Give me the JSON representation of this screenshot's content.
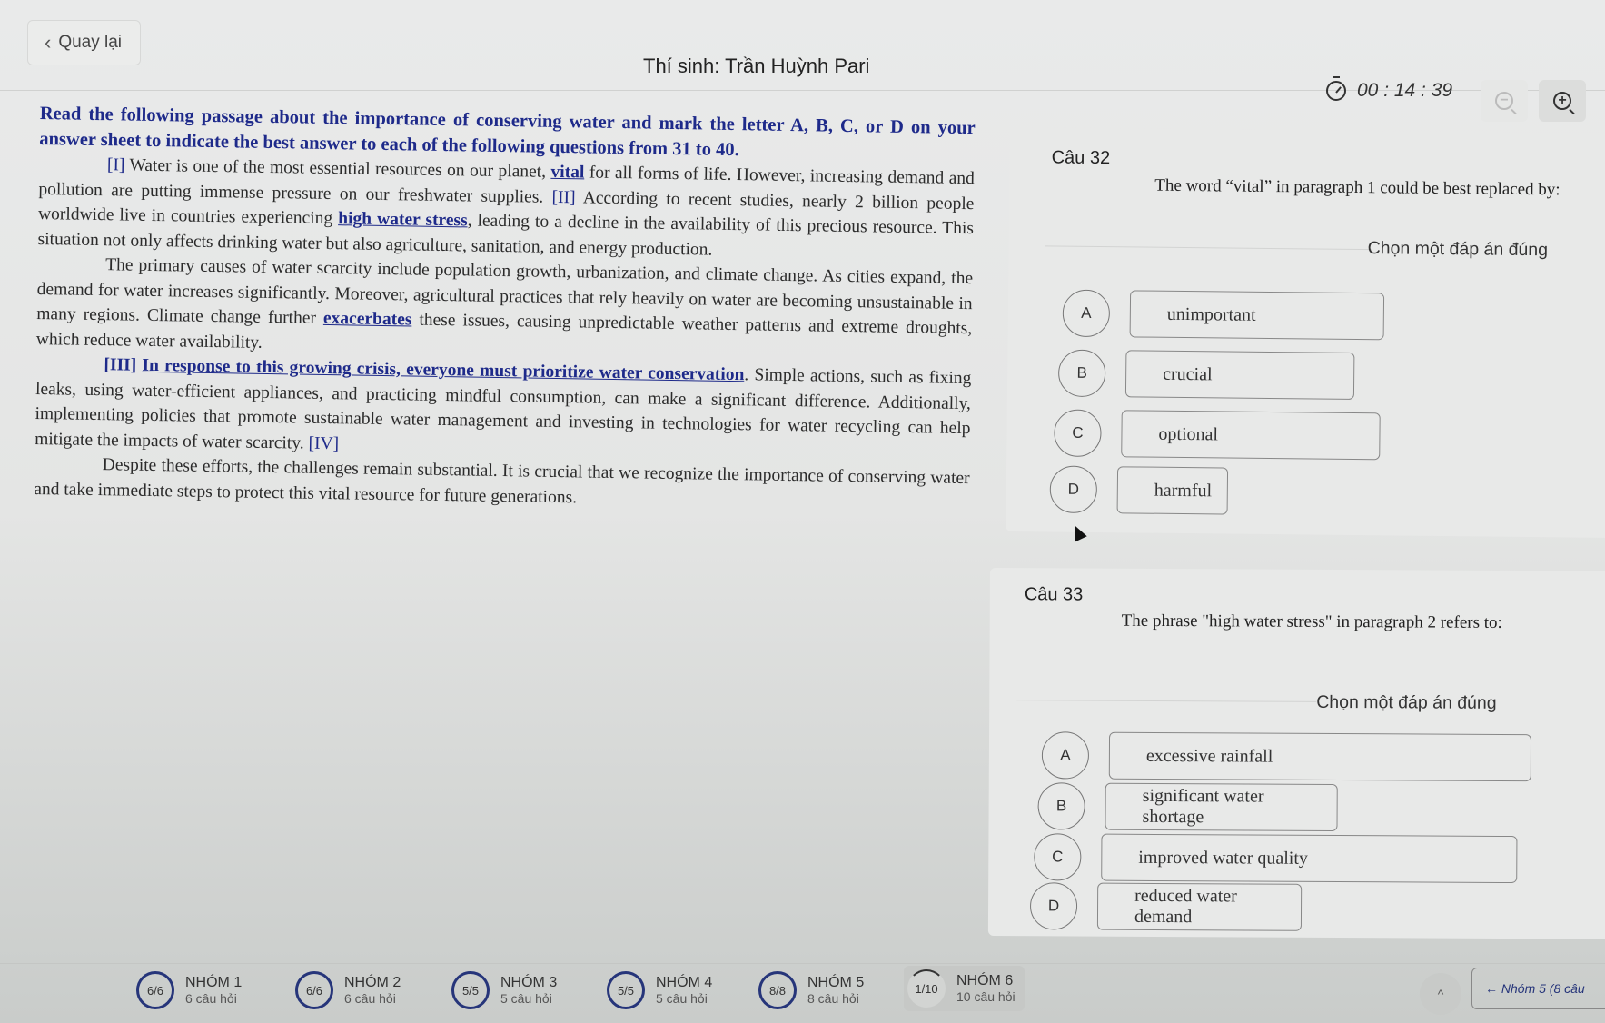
{
  "header": {
    "back_label": "Quay lại",
    "candidate_label": "Thí sinh: Trần Huỳnh Pari",
    "timer": "00 : 14 : 39",
    "zoom_out_icon": "zoom-out-icon",
    "zoom_in_icon": "zoom-in-icon"
  },
  "passage": {
    "instruction": "Read the following passage about the importance of conserving water and mark the letter A, B, C, or D on your answer sheet to indicate the best answer to each of the following questions from 31 to 40.",
    "p1": {
      "marker": "[I]",
      "t1": " Water is one of the most essential resources on our planet, ",
      "hl1": "vital",
      "t2": " for all forms of life. However, increasing demand and pollution are putting immense pressure on our freshwater supplies. ",
      "marker2": "[II]",
      "t3": " According to recent studies, nearly 2 billion people worldwide live in countries experiencing ",
      "hl2": "high water stress",
      "t4": ", leading to a decline in the availability of this precious resource. This situation not only affects drinking water but also agriculture, sanitation, and energy production."
    },
    "p2": {
      "t1": "The primary causes of water scarcity include population growth, urbanization, and climate change. As cities expand, the demand for water increases significantly. Moreover, agricultural practices that rely heavily on water are becoming unsustainable in many regions. Climate change further ",
      "hl1": "exacerbates",
      "t2": " these issues, causing unpredictable weather patterns and extreme droughts, which reduce water availability."
    },
    "p3": {
      "marker": "[III]",
      "hl1": "In response to this growing crisis, everyone must prioritize water conservation",
      "t1": ". Simple actions, such as fixing leaks, using water-efficient appliances, and practicing mindful consumption, can make a significant difference. Additionally, implementing policies that promote sustainable water management and investing in technologies for water recycling can help mitigate the impacts of water scarcity. ",
      "marker2": "[IV]"
    },
    "p4": {
      "t1": "Despite these efforts, the challenges remain substantial. It is crucial that we recognize the importance of conserving water and take immediate steps to protect this vital resource for future generations."
    }
  },
  "questions": [
    {
      "number": "Câu 32",
      "text": "The word “vital” in paragraph 1 could be best replaced by:",
      "choose_label": "Chọn một đáp án đúng",
      "options": [
        {
          "letter": "A",
          "text": "unimportant"
        },
        {
          "letter": "B",
          "text": "crucial"
        },
        {
          "letter": "C",
          "text": "optional"
        },
        {
          "letter": "D",
          "text": "harmful"
        }
      ]
    },
    {
      "number": "Câu 33",
      "text": "The phrase \"high water stress\" in paragraph 2 refers to:",
      "choose_label": "Chọn một đáp án đúng",
      "options": [
        {
          "letter": "A",
          "text": "excessive rainfall"
        },
        {
          "letter": "B",
          "text": "significant water shortage"
        },
        {
          "letter": "C",
          "text": "improved water quality"
        },
        {
          "letter": "D",
          "text": "reduced water demand"
        }
      ]
    }
  ],
  "footer": {
    "groups": [
      {
        "progress": "6/6",
        "name": "NHÓM 1",
        "count": "6 câu hỏi",
        "answered": 6,
        "total": 6
      },
      {
        "progress": "6/6",
        "name": "NHÓM 2",
        "count": "6 câu hỏi",
        "answered": 6,
        "total": 6
      },
      {
        "progress": "5/5",
        "name": "NHÓM 3",
        "count": "5 câu hỏi",
        "answered": 5,
        "total": 5
      },
      {
        "progress": "5/5",
        "name": "NHÓM 4",
        "count": "5 câu hỏi",
        "answered": 5,
        "total": 5
      },
      {
        "progress": "8/8",
        "name": "NHÓM 5",
        "count": "8 câu hỏi",
        "answered": 8,
        "total": 8
      },
      {
        "progress": "1/10",
        "name": "NHÓM 6",
        "count": "10 câu hỏi",
        "answered": 1,
        "total": 10
      }
    ],
    "up_icon": "^",
    "prev_label": "← Nhóm 5 (8 câu"
  }
}
